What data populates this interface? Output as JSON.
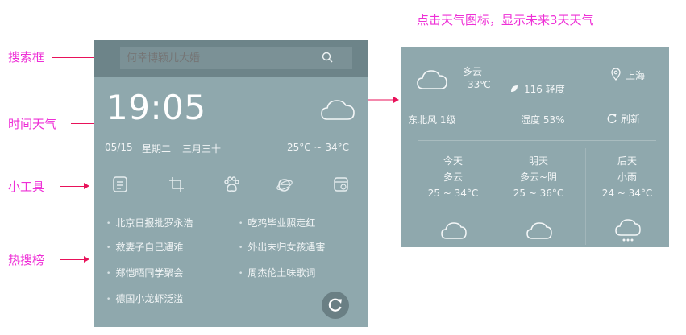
{
  "caption": "点击天气图标，显示未来3天天气",
  "annotations": {
    "search": "搜索框",
    "time_weather": "时间天气",
    "tools": "小工具",
    "hot_list": "热搜榜"
  },
  "search": {
    "value": "",
    "placeholder": "何幸博颖儿大婚"
  },
  "clock": {
    "time": "19:05",
    "date": "05/15",
    "weekday": "星期二",
    "lunar": "三月三十",
    "temp_range": "25°C ~ 34°C"
  },
  "tools": [
    {
      "icon": "notes-icon"
    },
    {
      "icon": "crop-icon"
    },
    {
      "icon": "paw-icon"
    },
    {
      "icon": "browser-icon"
    },
    {
      "icon": "calendar-icon"
    }
  ],
  "hot_search": [
    "北京日报批罗永浩",
    "吃鸡毕业照走红",
    "救妻子自己遇难",
    "外出未归女孩遇害",
    "郑恺晒同学聚会",
    "周杰伦土味歌词",
    "德国小龙虾泛滥"
  ],
  "weather_detail": {
    "condition": "多云",
    "temp": "33℃",
    "aqi": "116 轻度",
    "city": "上海",
    "wind": "东北风  1级",
    "humidity": "湿度  53%",
    "refresh_label": "刷新"
  },
  "forecast": [
    {
      "day": "今天",
      "condition": "多云",
      "range": "25 ~ 34°C",
      "icon": "cloud-icon"
    },
    {
      "day": "明天",
      "condition": "多云~阴",
      "range": "25 ~ 36°C",
      "icon": "cloud-icon"
    },
    {
      "day": "后天",
      "condition": "小雨",
      "range": "24 ~ 34°C",
      "icon": "rain-icon"
    }
  ],
  "colors": {
    "annotation": "#ee2fd6",
    "arrow": "#e8125a",
    "widget_bg": "#8fa8ad",
    "search_bg": "#6d8489"
  }
}
